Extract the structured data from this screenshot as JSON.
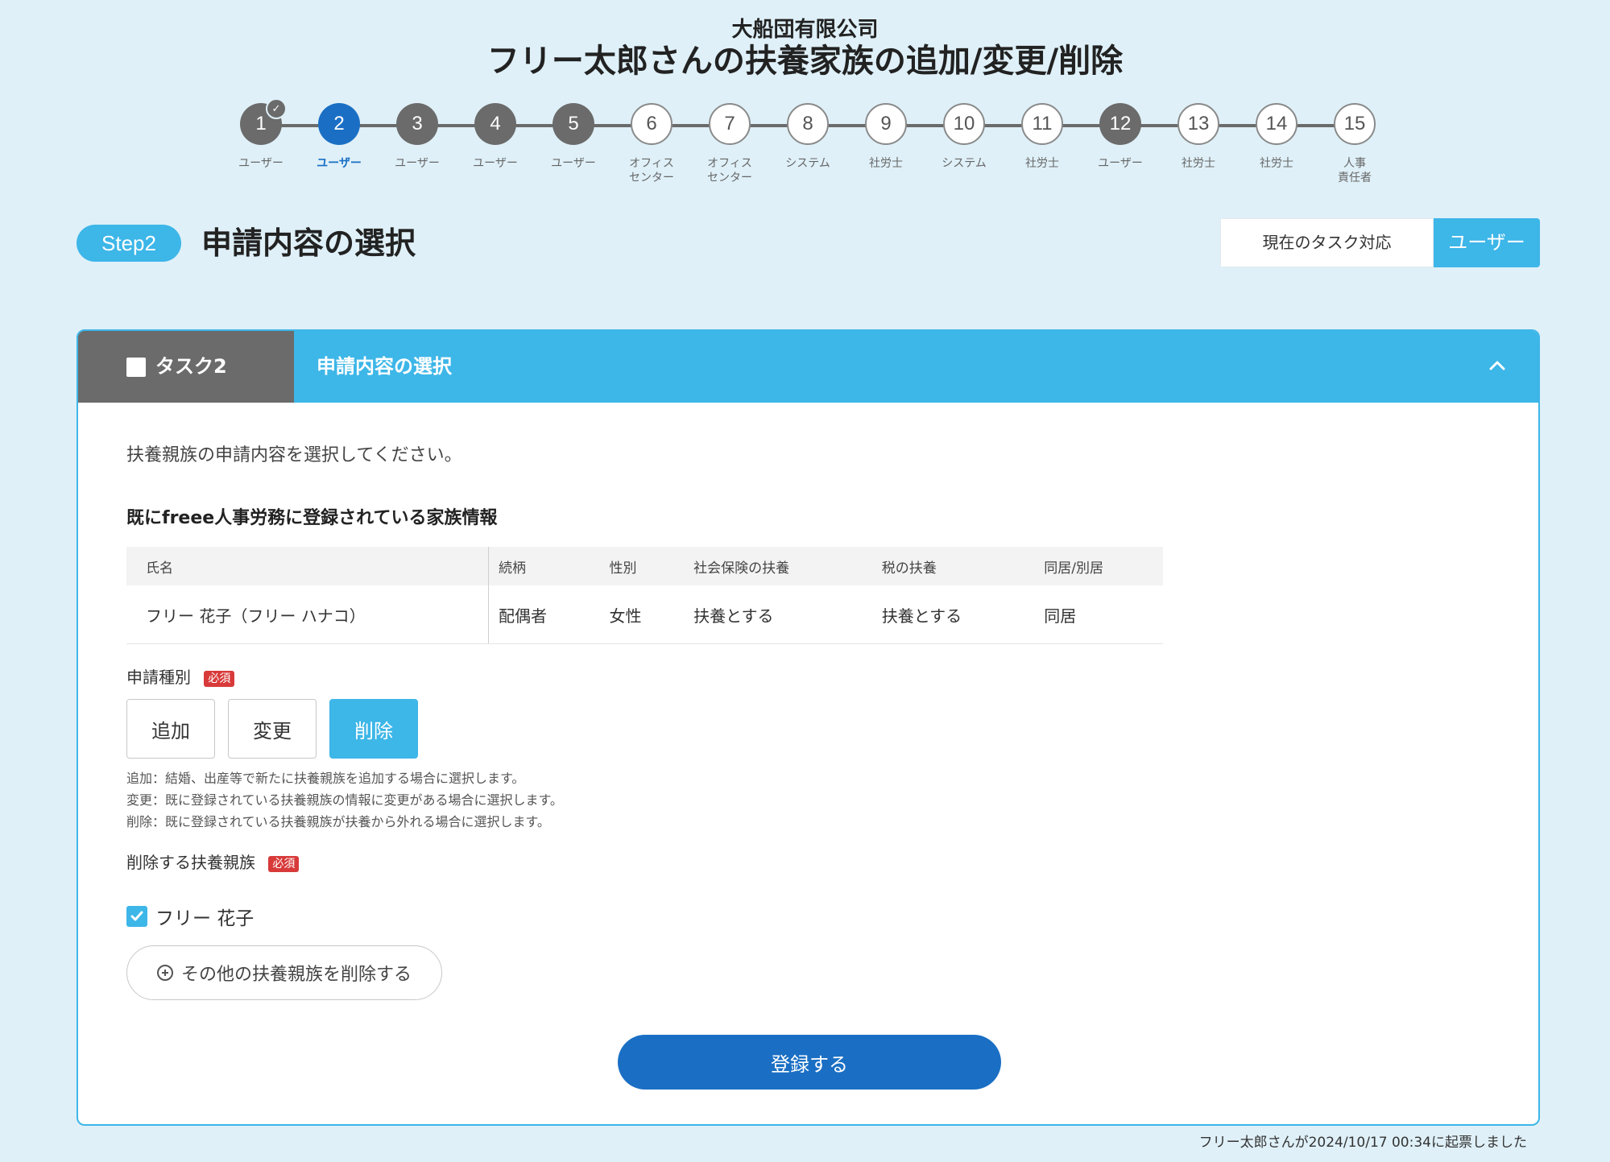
{
  "header": {
    "company": "大船団有限公司",
    "title": "フリー太郎さんの扶養家族の追加/変更/削除"
  },
  "steps": [
    {
      "number": "1",
      "label": "ユーザー",
      "state": "done",
      "checked": true
    },
    {
      "number": "2",
      "label": "ユーザー",
      "state": "current"
    },
    {
      "number": "3",
      "label": "ユーザー",
      "state": "done"
    },
    {
      "number": "4",
      "label": "ユーザー",
      "state": "done"
    },
    {
      "number": "5",
      "label": "ユーザー",
      "state": "done"
    },
    {
      "number": "6",
      "label": "オフィス\nセンター",
      "state": "todo"
    },
    {
      "number": "7",
      "label": "オフィス\nセンター",
      "state": "todo"
    },
    {
      "number": "8",
      "label": "システム",
      "state": "todo"
    },
    {
      "number": "9",
      "label": "社労士",
      "state": "todo"
    },
    {
      "number": "10",
      "label": "システム",
      "state": "todo"
    },
    {
      "number": "11",
      "label": "社労士",
      "state": "todo"
    },
    {
      "number": "12",
      "label": "ユーザー",
      "state": "done"
    },
    {
      "number": "13",
      "label": "社労士",
      "state": "todo"
    },
    {
      "number": "14",
      "label": "社労士",
      "state": "todo"
    },
    {
      "number": "15",
      "label": "人事\n責任者",
      "state": "todo"
    }
  ],
  "step_section": {
    "pill": "Step2",
    "title": "申請内容の選択"
  },
  "task_status": {
    "label": "現在のタスク対応",
    "value": "ユーザー"
  },
  "card": {
    "tab_label": "タスク2",
    "header_title": "申請内容の選択",
    "instruction": "扶養親族の申請内容を選択してください。",
    "family_heading": "既にfreee人事労務に登録されている家族情報",
    "table": {
      "headers": [
        "氏名",
        "続柄",
        "性別",
        "社会保険の扶養",
        "税の扶養",
        "同居/別居"
      ],
      "rows": [
        [
          "フリー 花子（フリー ハナコ）",
          "配偶者",
          "女性",
          "扶養とする",
          "扶養とする",
          "同居"
        ]
      ]
    },
    "application_type": {
      "label": "申請種別",
      "required": "必須",
      "options": [
        "追加",
        "変更",
        "削除"
      ],
      "selected": "削除",
      "help": [
        "追加：結婚、出産等で新たに扶養親族を追加する場合に選択します。",
        "変更：既に登録されている扶養親族の情報に変更がある場合に選択します。",
        "削除：既に登録されている扶養親族が扶養から外れる場合に選択します。"
      ]
    },
    "delete_target": {
      "label": "削除する扶養親族",
      "required": "必須",
      "checkbox_label": "フリー 花子",
      "checked": true,
      "add_other_label": "その他の扶養親族を削除する"
    },
    "submit_label": "登録する"
  },
  "footer_note": "フリー太郎さんが2024/10/17 00:34に起票しました",
  "colors": {
    "background": "#dff0f8",
    "accent": "#3db6e8",
    "primary": "#1a6fc4",
    "step_done": "#6b6b6b",
    "required": "#d83a3a"
  }
}
